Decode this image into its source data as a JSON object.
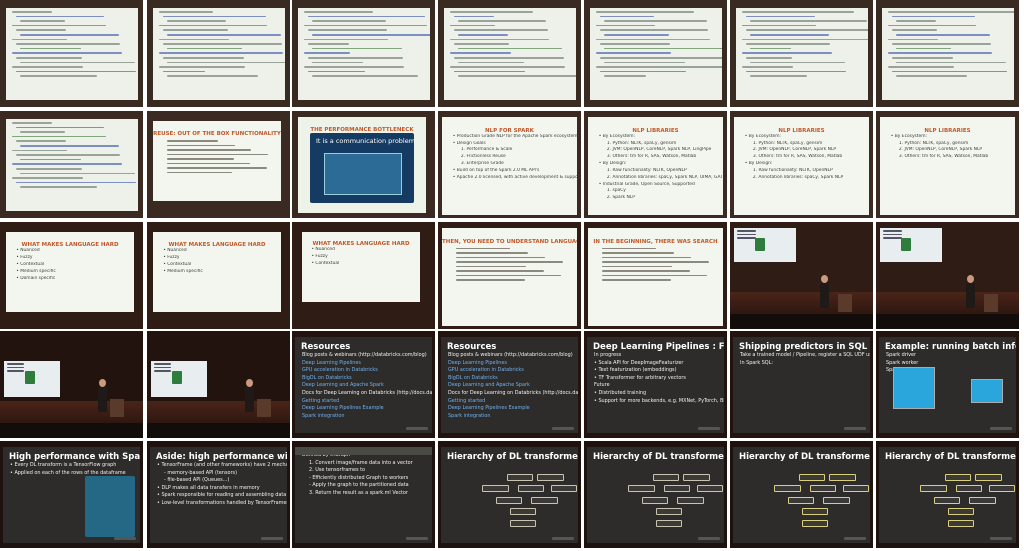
{
  "tiles": [
    {
      "id": "r1c1",
      "slide": "code"
    },
    {
      "id": "r1c2",
      "slide": "code"
    },
    {
      "id": "r1c3",
      "slide": "code"
    },
    {
      "id": "r1c4",
      "slide": "code"
    },
    {
      "id": "r1c5",
      "slide": "code"
    },
    {
      "id": "r1c6",
      "slide": "code"
    },
    {
      "id": "r1c7",
      "slide": "code"
    },
    {
      "id": "r2c1",
      "slide": "code"
    },
    {
      "id": "r2c2",
      "slide": "light",
      "title": "REUSE: OUT OF THE BOX FUNCTIONALITY"
    },
    {
      "id": "r2c3",
      "slide": "light",
      "title": "THE PERFORMANCE BOTTLENECK",
      "body": [
        "It is a communication problem"
      ]
    },
    {
      "id": "r2c4",
      "slide": "light",
      "title": "NLP FOR SPARK",
      "body": [
        "• Production Grade NLP for the Apache Spark ecosystem",
        "• Design Goals",
        "1. Performance & Scale",
        "2. Frictionless Reuse",
        "3. Enterprise Grade",
        "• Build on top of the Spark 2.0 ML API's",
        "• Apache 2.0 licensed, with active development & support"
      ]
    },
    {
      "id": "r2c5",
      "slide": "light",
      "title": "NLP LIBRARIES",
      "body": [
        "• By Ecosystem:",
        "1. Python: NLTK, spaCy, gensim",
        "2. JVM: OpenNLP, CoreNLP, Spark NLP, LingPipe",
        "3. Others: tm for R, SAS, Watson, Matlab",
        "• By Design:",
        "1. Raw functionality: NLTK, OpenNLP",
        "2. Annotation libraries: spaCy, Spark NLP, UIMA, GATE",
        "• Industrial Grade, Open Source, Supported",
        "1. spaCy",
        "2. Spark NLP"
      ]
    },
    {
      "id": "r2c6",
      "slide": "light",
      "title": "NLP LIBRARIES",
      "body": [
        "• By Ecosystem:",
        "1. Python: NLTK, spaCy, gensim",
        "2. JVM: OpenNLP, CoreNLP, Spark NLP",
        "3. Others: tm for R, SAS, Watson, Matlab",
        "• By Design:",
        "1. Raw functionality: NLTK, OpenNLP",
        "2. Annotation libraries: spaCy, Spark NLP"
      ]
    },
    {
      "id": "r2c7",
      "slide": "light",
      "title": "NLP LIBRARIES",
      "body": [
        "• By Ecosystem:",
        "1. Python: NLTK, spaCy, gensim",
        "2. JVM: OpenNLP, CoreNLP, Spark NLP",
        "3. Others: tm for R, SAS, Watson, Matlab"
      ]
    },
    {
      "id": "r3c1",
      "slide": "light",
      "title": "WHAT MAKES LANGUAGE HARD",
      "body": [
        "• Nuanced",
        "• Fuzzy",
        "• Contextual",
        "• Medium specific",
        "• Domain specific"
      ]
    },
    {
      "id": "r3c2",
      "slide": "light",
      "title": "WHAT MAKES LANGUAGE HARD",
      "body": [
        "• Nuanced",
        "• Fuzzy",
        "• Contextual",
        "• Medium specific"
      ]
    },
    {
      "id": "r3c3",
      "slide": "light",
      "title": "WHAT MAKES LANGUAGE HARD",
      "body": [
        "• Nuanced",
        "• Fuzzy",
        "• Contextual"
      ]
    },
    {
      "id": "r3c4",
      "slide": "light",
      "title": "THEN, YOU NEED TO UNDERSTAND LANGUAGE"
    },
    {
      "id": "r3c5",
      "slide": "light",
      "title": "IN THE BEGINNING, THERE WAS SEARCH"
    },
    {
      "id": "r3c6",
      "slide": "stage"
    },
    {
      "id": "r3c7",
      "slide": "stage"
    },
    {
      "id": "r4c1",
      "slide": "stage"
    },
    {
      "id": "r4c2",
      "slide": "stage"
    },
    {
      "id": "r4c3",
      "slide": "dark",
      "title": "Resources",
      "body": [
        "Blog posts & webinars (http://databricks.com/blog)",
        "Deep Learning Pipelines",
        "GPU acceleration in Databricks",
        "BigDL on Databricks",
        "Deep Learning and Apache Spark",
        "Docs for Deep Learning on Databricks (http://docs.databricks.com)",
        "Getting started",
        "Deep Learning Pipelines Example",
        "Spark integration"
      ]
    },
    {
      "id": "r4c4",
      "slide": "dark",
      "title": "Resources",
      "body": [
        "Blog posts & webinars (http://databricks.com/blog)",
        "Deep Learning Pipelines",
        "GPU acceleration in Databricks",
        "BigDL on Databricks",
        "Deep Learning and Apache Spark",
        "Docs for Deep Learning on Databricks (http://docs.databricks.com)",
        "Getting started",
        "Deep Learning Pipelines Example",
        "Spark integration"
      ]
    },
    {
      "id": "r4c5",
      "slide": "dark",
      "title": "Deep Learning Pipelines : Future",
      "body": [
        "In progress",
        "• Scala API for DeepImageFeaturizer",
        "• Text featurization (embeddings)",
        "• TF Transformer for arbitrary vectors",
        "Future",
        "• Distributed training",
        "• Support for more backends, e.g. MXNet, PyTorch, BigDL"
      ]
    },
    {
      "id": "r4c6",
      "slide": "dark",
      "title": "Shipping predictors in SQL",
      "body": [
        "Take a trained model / Pipeline, register a SQL UDF usable by anyone in the organization",
        "In Spark SQL:"
      ]
    },
    {
      "id": "r4c7",
      "slide": "dark",
      "title": "Example: running batch inference",
      "body": [
        "Spark driver",
        "Spark worker",
        "Spark worker"
      ]
    },
    {
      "id": "r5c1",
      "slide": "dark",
      "title": "High performance with Spark",
      "body": [
        "• Every DL transform is a TensorFlow graph",
        "• Applied on each of the rows of the dataframe"
      ]
    },
    {
      "id": "r5c2",
      "slide": "dark",
      "title": "Aside: high performance with Spark",
      "body": [
        "• TensorFrame (and other frameworks) have 2 mechanisms to ingest data:",
        "- memory-based API (tensors)",
        "- file-based API (Queues...)",
        "• DLP makes all data transfers in memory",
        "• Spark responsible for reading and assembling data",
        "• Low-level transformations handled by TensorFrames"
      ]
    },
    {
      "id": "r5c3",
      "slide": "dark",
      "title": "",
      "body": [
        "Defined by tf.Graph",
        "1. Convert image/frame data into a vector",
        "2. Use tensorframes to",
        "- Efficiently distributed Graph to workers",
        "- Apply the graph to the partitioned data",
        "3. Return the result as a spark.ml Vector"
      ]
    },
    {
      "id": "r5c4",
      "slide": "dark",
      "title": "Hierarchy of DL transformers"
    },
    {
      "id": "r5c5",
      "slide": "dark",
      "title": "Hierarchy of DL transformers"
    },
    {
      "id": "r5c6",
      "slide": "dark",
      "title": "Hierarchy of DL transformers for images"
    },
    {
      "id": "r5c7",
      "slide": "dark",
      "title": "Hierarchy of DL transformers for images"
    }
  ],
  "colors": {
    "light_title": "#c0582a",
    "link": "#6fb0f0",
    "dark_bg": "#2d2c2a",
    "slide_bg": "#f3f6ee"
  }
}
